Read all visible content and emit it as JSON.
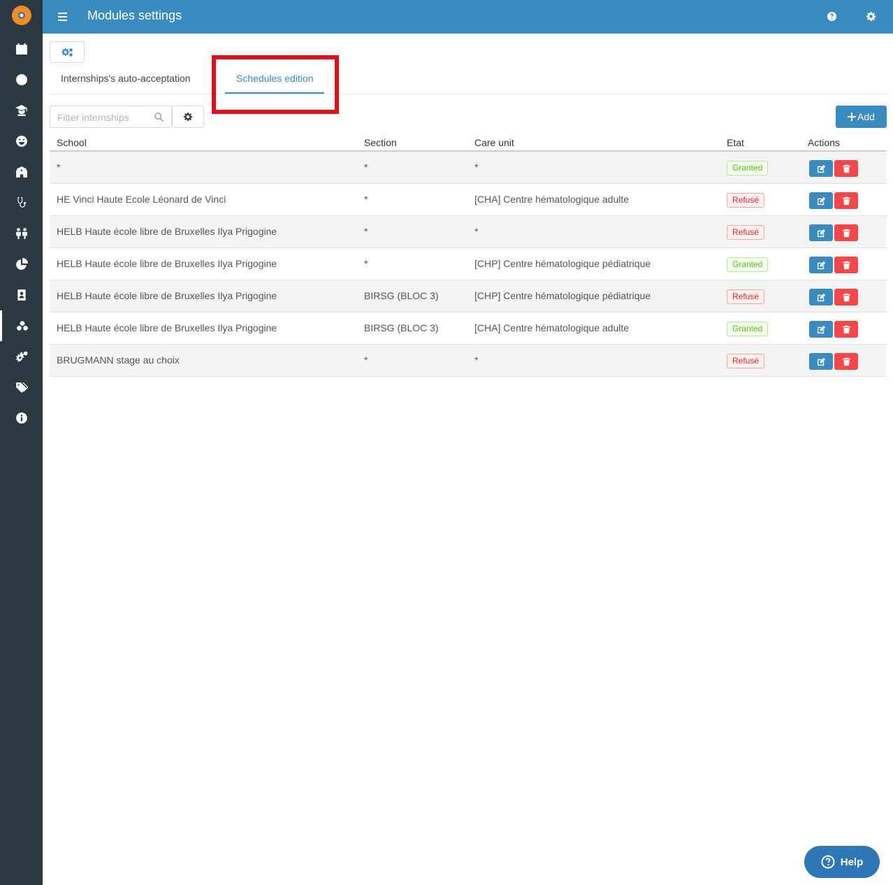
{
  "header": {
    "title": "Modules settings"
  },
  "tabs": [
    {
      "label": "Internships's auto-acceptation",
      "active": false
    },
    {
      "label": "Schedules edition",
      "active": true
    }
  ],
  "filter": {
    "placeholder": "Filter internships"
  },
  "add_button": {
    "label": "Add"
  },
  "table": {
    "columns": [
      "School",
      "Section",
      "Care unit",
      "Etat",
      "Actions"
    ],
    "rows": [
      {
        "school": "*",
        "section": "*",
        "care_unit": "*",
        "etat": "Granted",
        "status": "granted"
      },
      {
        "school": "HE Vinci Haute Ecole Léonard de Vinci",
        "section": "*",
        "care_unit": "[CHA] Centre hématologique adulte",
        "etat": "Refusé",
        "status": "refused"
      },
      {
        "school": "HELB Haute école libre de Bruxelles Ilya Prigogine",
        "section": "*",
        "care_unit": "*",
        "etat": "Refusé",
        "status": "refused"
      },
      {
        "school": "HELB Haute école libre de Bruxelles Ilya Prigogine",
        "section": "*",
        "care_unit": "[CHP] Centre hématologique pédiatrique",
        "etat": "Granted",
        "status": "granted"
      },
      {
        "school": "HELB Haute école libre de Bruxelles Ilya Prigogine",
        "section": "BIRSG (BLOC 3)",
        "care_unit": "[CHP] Centre hématologique pédiatrique",
        "etat": "Refusé",
        "status": "refused"
      },
      {
        "school": "HELB Haute école libre de Bruxelles Ilya Prigogine",
        "section": "BIRSG (BLOC 3)",
        "care_unit": "[CHA] Centre hématologique adulte",
        "etat": "Granted",
        "status": "granted"
      },
      {
        "school": "BRUGMANN stage au choix",
        "section": "*",
        "care_unit": "*",
        "etat": "Refusé",
        "status": "refused"
      }
    ]
  },
  "help_button": {
    "label": "Help"
  },
  "sidebar": {
    "items": [
      {
        "icon": "calendar-icon"
      },
      {
        "icon": "clock-icon"
      },
      {
        "icon": "graduate-icon"
      },
      {
        "icon": "smile-icon"
      },
      {
        "icon": "building-icon"
      },
      {
        "icon": "stethoscope-icon"
      },
      {
        "icon": "people-icon"
      },
      {
        "icon": "pie-chart-icon"
      },
      {
        "icon": "contact-book-icon"
      },
      {
        "icon": "modules-icon",
        "active": true
      },
      {
        "icon": "cogs-icon"
      },
      {
        "icon": "tags-icon"
      },
      {
        "icon": "info-icon"
      }
    ]
  },
  "colors": {
    "primary": "#3a8bbf",
    "sidebar": "#2b3a42",
    "danger": "#f5464a",
    "highlight": "#e0101a",
    "granted": "#52c41a",
    "refused": "#f5222d"
  }
}
